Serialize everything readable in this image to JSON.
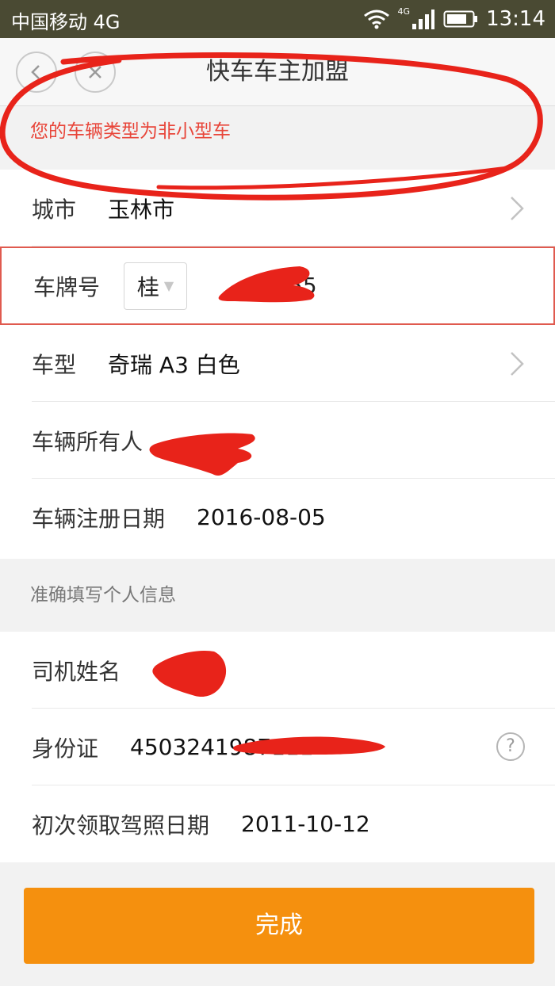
{
  "status_bar": {
    "carrier": "中国移动 4G",
    "network_tag": "4G",
    "time": "13:14"
  },
  "nav": {
    "title": "快车车主加盟",
    "back_icon": "back-icon",
    "close_icon": "close-icon"
  },
  "warning": "您的车辆类型为非小型车",
  "vehicle": {
    "city_label": "城市",
    "city_value": "玉林市",
    "plate_label": "车牌号",
    "plate_province": "桂",
    "plate_number_suffix": "55",
    "model_label": "车型",
    "model_value": "奇瑞 A3 白色",
    "owner_label": "车辆所有人",
    "reg_date_label": "车辆注册日期",
    "reg_date_value": "2016-08-05"
  },
  "personal_header": "准确填写个人信息",
  "personal": {
    "name_label": "司机姓名",
    "id_label": "身份证",
    "id_value": "4503241987111",
    "license_date_label": "初次领取驾照日期",
    "license_date_value": "2011-10-12"
  },
  "submit_label": "完成",
  "colors": {
    "accent": "#f5900e",
    "warning": "#e8463a",
    "status_bar": "#4a4a33",
    "marker": "#e8231a"
  }
}
